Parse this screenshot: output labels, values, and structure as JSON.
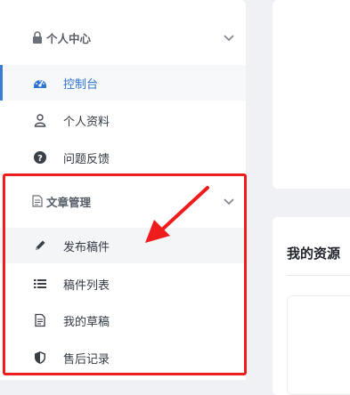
{
  "sidebar": {
    "groups": [
      {
        "title": "个人中心",
        "icon": "lock-icon",
        "items": [
          {
            "label": "控制台",
            "icon": "dashboard-icon",
            "active": true
          },
          {
            "label": "个人资料",
            "icon": "user-icon"
          },
          {
            "label": "问题反馈",
            "icon": "question-icon"
          }
        ]
      },
      {
        "title": "文章管理",
        "icon": "document-icon",
        "items": [
          {
            "label": "发布稿件",
            "icon": "pencil-icon"
          },
          {
            "label": "稿件列表",
            "icon": "list-icon"
          },
          {
            "label": "我的草稿",
            "icon": "file-icon"
          },
          {
            "label": "售后记录",
            "icon": "shield-icon"
          }
        ]
      }
    ]
  },
  "main": {
    "resource_title": "我的资源"
  },
  "colors": {
    "accent": "#2f74d0",
    "annotation": "#ee1c1c"
  }
}
